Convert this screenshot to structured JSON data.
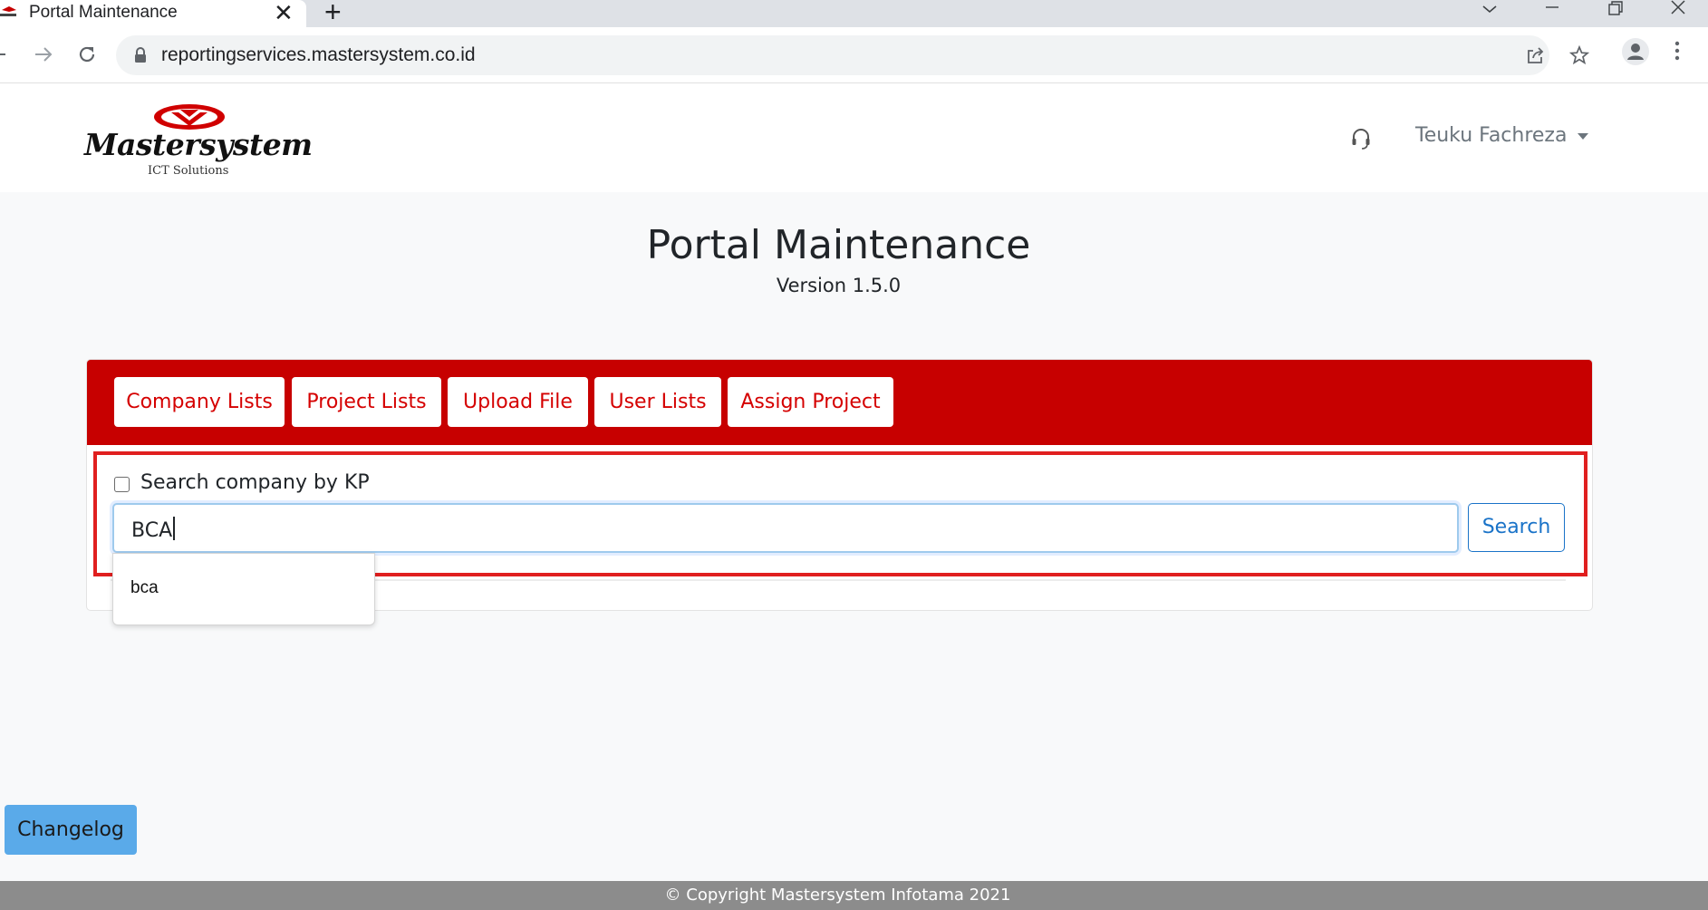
{
  "browser": {
    "tab_title": "Portal Maintenance",
    "tab_close_glyph": "✕",
    "new_tab_glyph": "+",
    "url": "reportingservices.mastersystem.co.id"
  },
  "header": {
    "logo_name": "Mastersystem",
    "logo_tagline": "ICT Solutions",
    "user_name": "Teuku Fachreza"
  },
  "page": {
    "title": "Portal Maintenance",
    "version": "Version 1.5.0"
  },
  "nav": {
    "company_lists": "Company Lists",
    "project_lists": "Project Lists",
    "upload_file": "Upload File",
    "user_lists": "User Lists",
    "assign_project": "Assign Project"
  },
  "search": {
    "checkbox_label": "Search company by KP",
    "checkbox_checked": false,
    "value": "BCA",
    "button_label": "Search",
    "suggestions": [
      "bca"
    ]
  },
  "changelog_label": "Changelog",
  "footer_text": "© Copyright Mastersystem Infotama 2021",
  "colors": {
    "brand_red": "#c70000",
    "nav_text_red": "#d50000",
    "link_blue": "#1a73c8",
    "changelog_blue": "#5aaae9",
    "footer_gray": "#8c8c8c"
  }
}
